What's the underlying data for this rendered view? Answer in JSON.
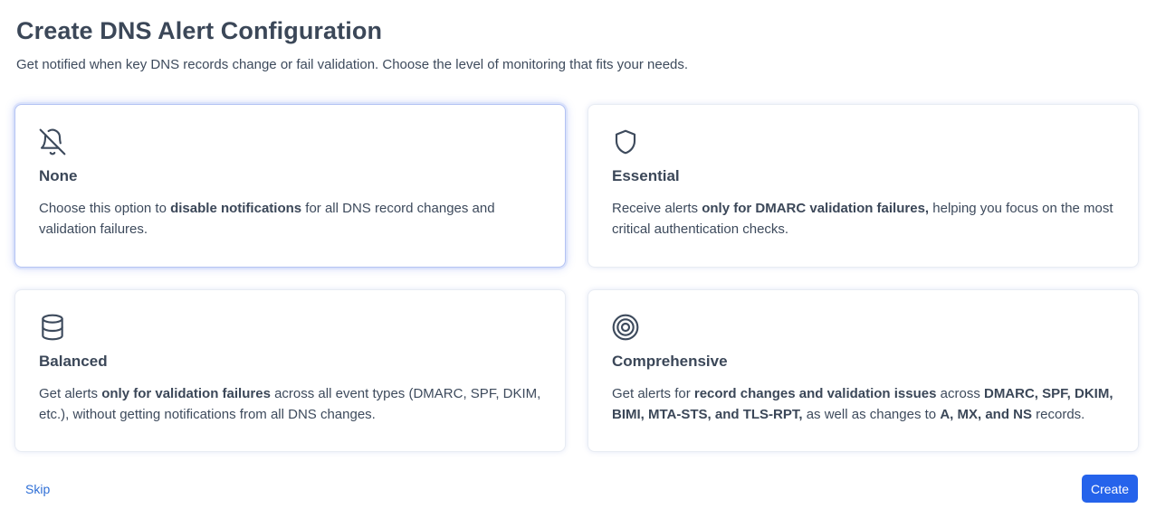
{
  "header": {
    "title": "Create DNS Alert Configuration",
    "subtitle": "Get notified when key DNS records change or fail validation. Choose the level of monitoring that fits your needs."
  },
  "options": [
    {
      "title": "None",
      "icon": "bell-off-icon",
      "selected": true,
      "desc": [
        {
          "t": "Choose this option to "
        },
        {
          "t": "disable notifications",
          "b": true
        },
        {
          "t": " for all DNS record changes and validation failures."
        }
      ]
    },
    {
      "title": "Essential",
      "icon": "shield-icon",
      "selected": false,
      "desc": [
        {
          "t": "Receive alerts "
        },
        {
          "t": "only for DMARC validation failures,",
          "b": true
        },
        {
          "t": " helping you focus on the most critical authentication checks."
        }
      ]
    },
    {
      "title": "Balanced",
      "icon": "database-icon",
      "selected": false,
      "desc": [
        {
          "t": "Get alerts "
        },
        {
          "t": "only for validation failures",
          "b": true
        },
        {
          "t": " across all event types (DMARC, SPF, DKIM, etc.), without getting notifications from all DNS changes."
        }
      ]
    },
    {
      "title": "Comprehensive",
      "icon": "target-icon",
      "selected": false,
      "desc": [
        {
          "t": "Get alerts for "
        },
        {
          "t": "record changes and validation issues",
          "b": true
        },
        {
          "t": " across "
        },
        {
          "t": "DMARC, SPF, DKIM, BIMI, MTA-STS, and TLS-RPT,",
          "b": true
        },
        {
          "t": " as well as changes to "
        },
        {
          "t": "A, MX, and NS",
          "b": true
        },
        {
          "t": " records."
        }
      ]
    }
  ],
  "footer": {
    "skip_label": "Skip",
    "create_label": "Create"
  },
  "colors": {
    "accent": "#2563eb",
    "link": "#2f6fd6",
    "text": "#3d4a5c",
    "selected_border": "#b3c2f3"
  }
}
